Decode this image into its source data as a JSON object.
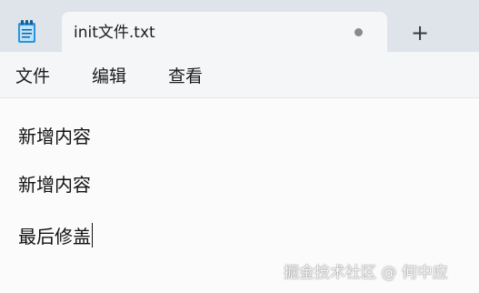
{
  "tab": {
    "title": "init文件.txt"
  },
  "new_tab_label": "+",
  "menu": {
    "items": [
      {
        "label": "文件"
      },
      {
        "label": "编辑"
      },
      {
        "label": "查看"
      }
    ]
  },
  "editor": {
    "lines": [
      "新增内容",
      "新增内容",
      "最后修盖"
    ]
  },
  "watermark": "掘金技术社区 @ 何中应",
  "icons": {
    "app": "notepad-icon",
    "unsaved": "unsaved-dot-icon"
  },
  "colors": {
    "titlebar": "#dfe4ea",
    "tab": "#f4f6f8",
    "editor": "#fbfbfb"
  }
}
